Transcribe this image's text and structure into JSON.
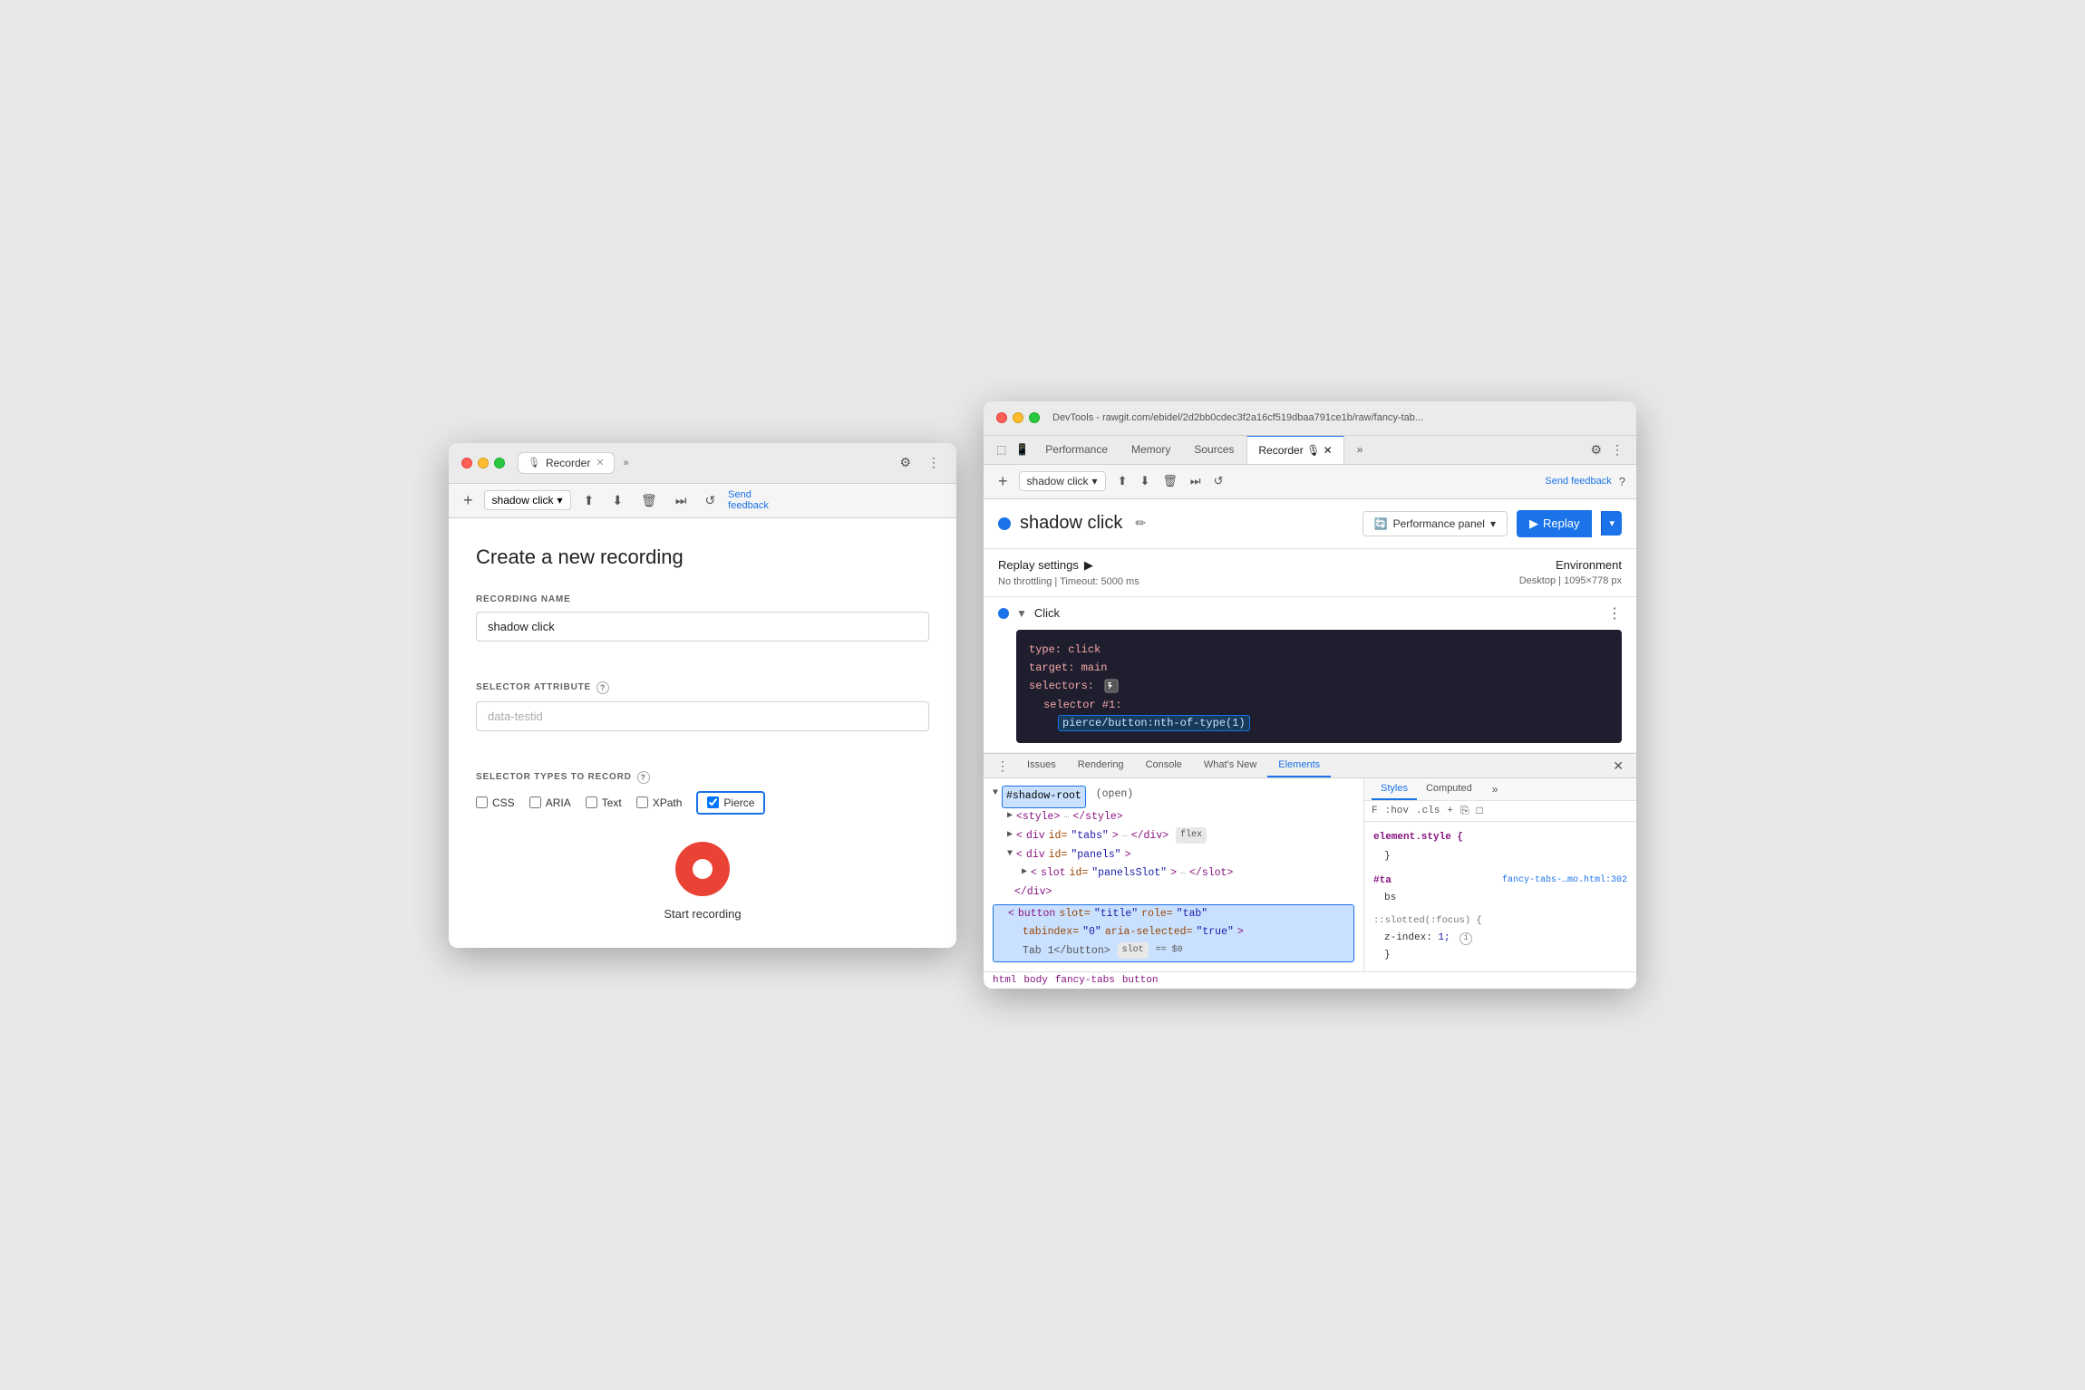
{
  "left_window": {
    "title": "DevTools - rawgit.com/ebidel/2d2bb0cdec3f2a16cf519...",
    "tab_label": "Recorder",
    "tab_icon": "🎙",
    "recording_name": "shadow click",
    "create_title": "Create a new recording",
    "recording_name_label": "RECORDING NAME",
    "recording_name_value": "shadow click",
    "selector_attr_label": "SELECTOR ATTRIBUTE",
    "selector_attr_placeholder": "data-testid",
    "selector_types_label": "SELECTOR TYPES TO RECORD",
    "checkboxes": [
      {
        "id": "css",
        "label": "CSS",
        "checked": false
      },
      {
        "id": "aria",
        "label": "ARIA",
        "checked": false
      },
      {
        "id": "text",
        "label": "Text",
        "checked": false
      },
      {
        "id": "xpath",
        "label": "XPath",
        "checked": false
      },
      {
        "id": "pierce",
        "label": "Pierce",
        "checked": true
      }
    ],
    "start_recording_label": "Start recording"
  },
  "right_window": {
    "title": "DevTools - rawgit.com/ebidel/2d2bb0cdec3f2a16cf519dbaa791ce1b/raw/fancy-tab...",
    "tab_label": "Recorder",
    "devtools_tabs": [
      "Performance",
      "Memory",
      "Sources",
      "Recorder",
      "Elements"
    ],
    "active_tab": "Recorder",
    "recording_name": "shadow click",
    "send_feedback_label": "Send feedback",
    "recording_title": "shadow click",
    "performance_panel_label": "Performance panel",
    "replay_label": "Replay",
    "replay_settings": {
      "title": "Replay settings",
      "no_throttling": "No throttling",
      "timeout": "Timeout: 5000 ms"
    },
    "environment": {
      "label": "Environment",
      "desktop": "Desktop",
      "resolution": "1095×778 px"
    },
    "step": {
      "title": "Click",
      "type_key": "type:",
      "type_val": "click",
      "target_key": "target:",
      "target_val": "main",
      "selectors_key": "selectors:",
      "selector1_key": "selector #1:",
      "selector1_val": "pierce/button:nth-of-type(1)"
    }
  },
  "bottom_panel": {
    "tabs": [
      "Issues",
      "Rendering",
      "Console",
      "What's New",
      "Elements"
    ],
    "active_tab": "Elements",
    "dom": {
      "shadow_root": "#shadow-root",
      "open_label": "(open)",
      "style_tag": "<style>",
      "style_ellipsis": "…</style>",
      "div_tabs": "<div id=\"tabs\">",
      "div_tabs_end": "…</div>",
      "flex_badge": "flex",
      "div_panels": "<div id=\"panels\">",
      "slot_panels": "<slot id=\"panelsSlot\">",
      "slot_ellipsis": "…</slot>",
      "div_end": "</div>",
      "button_line": "<button slot=\"title\" role=\"tab\"",
      "button_attr": "tabindex=\"0\" aria-selected=\"true\">",
      "button_text": "Tab 1</button>",
      "slot_badge": "slot",
      "dollar_badge": "$0"
    },
    "styles": {
      "tabs": [
        "Styles",
        "Computed"
      ],
      "filter_placeholder": "F",
      "hov_label": ":hov",
      "cls_label": ".cls",
      "element_style": "element.style {",
      "closing_brace": "}",
      "rule_selector": "#ta",
      "rule_file": "fancy-tabs-…mo.html:302",
      "rule_content2": "bs",
      "pseudo_selector": "::slotted(:focus) {",
      "prop_name": "z-index:",
      "prop_val": "1;"
    },
    "breadcrumb": [
      "html",
      "body",
      "fancy-tabs",
      "button"
    ]
  }
}
